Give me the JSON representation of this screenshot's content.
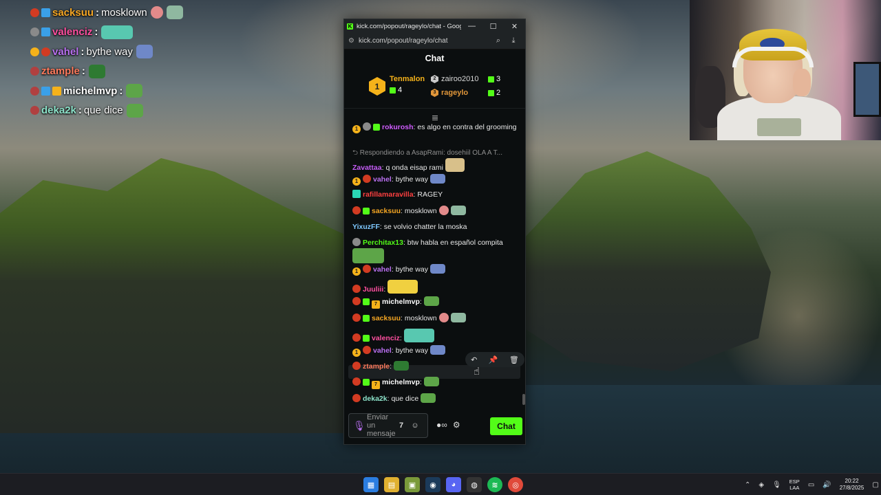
{
  "overlay_chat": [
    {
      "user": "sacksuu",
      "msg": "mosklown",
      "color": "#f5a623"
    },
    {
      "user": "valenciz",
      "msg": "",
      "color": "#ff4fa0"
    },
    {
      "user": "vahel",
      "msg": "bythe way",
      "color": "#b970f0"
    },
    {
      "user": "ztample",
      "msg": "",
      "color": "#ff7a5c"
    },
    {
      "user": "michelmvp",
      "msg": "",
      "color": "#ffffff"
    },
    {
      "user": "deka2k",
      "msg": "que dice",
      "color": "#8ce2c9"
    }
  ],
  "window": {
    "title": "kick.com/popout/rageylo/chat - Google C...",
    "url": "kick.com/popout/rageylo/chat",
    "minimize": "—",
    "maximize": "☐",
    "close": "✕"
  },
  "chat": {
    "header": "Chat",
    "leaderboard": {
      "first": {
        "rank": "1",
        "name": "Tenmalon",
        "count": "4"
      },
      "second": {
        "name": "zairoo2010",
        "count": "3"
      },
      "third": {
        "name": "rageylo",
        "count": "2"
      }
    },
    "messages": [
      {
        "user": "rokurosh",
        "text": ": es algo en contra del grooming",
        "color": "#d05cff"
      },
      {
        "reply": "Respondiendo a AsapRami: dosehiil OLA A T...",
        "user": "Zavattaa",
        "text": ": q onda eisap rami",
        "color": "#c45cf5"
      },
      {
        "user": "vahel",
        "text": ": bythe way",
        "color": "#b970f0"
      },
      {
        "user": "rafillamaravilla",
        "text": ": RAGEY",
        "color": "#ff4040"
      },
      {
        "user": "sacksuu",
        "text": ": mosklown",
        "color": "#f5a623"
      },
      {
        "user": "YixuzFF",
        "text": ": se volvio chatter la moska",
        "color": "#7ec8ff"
      },
      {
        "user": "Perchitax13",
        "text": ": btw habla en español compita",
        "color": "#53fc18"
      },
      {
        "user": "vahel",
        "text": ": bythe way",
        "color": "#b970f0"
      },
      {
        "user": "Juuliii",
        "text": ":",
        "color": "#ff4fa0"
      },
      {
        "user": "michelmvp",
        "text": ":",
        "color": "#ffffff"
      },
      {
        "user": "sacksuu",
        "text": ": mosklown",
        "color": "#f5a623"
      },
      {
        "user": "valenciz",
        "text": ":",
        "color": "#ff4fa0"
      },
      {
        "user": "vahel",
        "text": ": bythe way",
        "color": "#b970f0"
      },
      {
        "user": "ztample",
        "text": ":",
        "color": "#ff7a5c"
      },
      {
        "user": "michelmvp",
        "text": ":",
        "color": "#ffffff"
      },
      {
        "user": "deka2k",
        "text": ": que dice",
        "color": "#8ce2c9"
      }
    ],
    "composer_placeholder": "Enviar un mensaje",
    "send_label": "Chat"
  },
  "taskbar": {
    "lang_1": "ESP",
    "lang_2": "LAA",
    "time": "20:22",
    "date": "27/8/2025"
  },
  "colors": {
    "kick_green": "#53fc18",
    "gold_badge": "#f5b21a",
    "bronze": "#e0963a"
  }
}
